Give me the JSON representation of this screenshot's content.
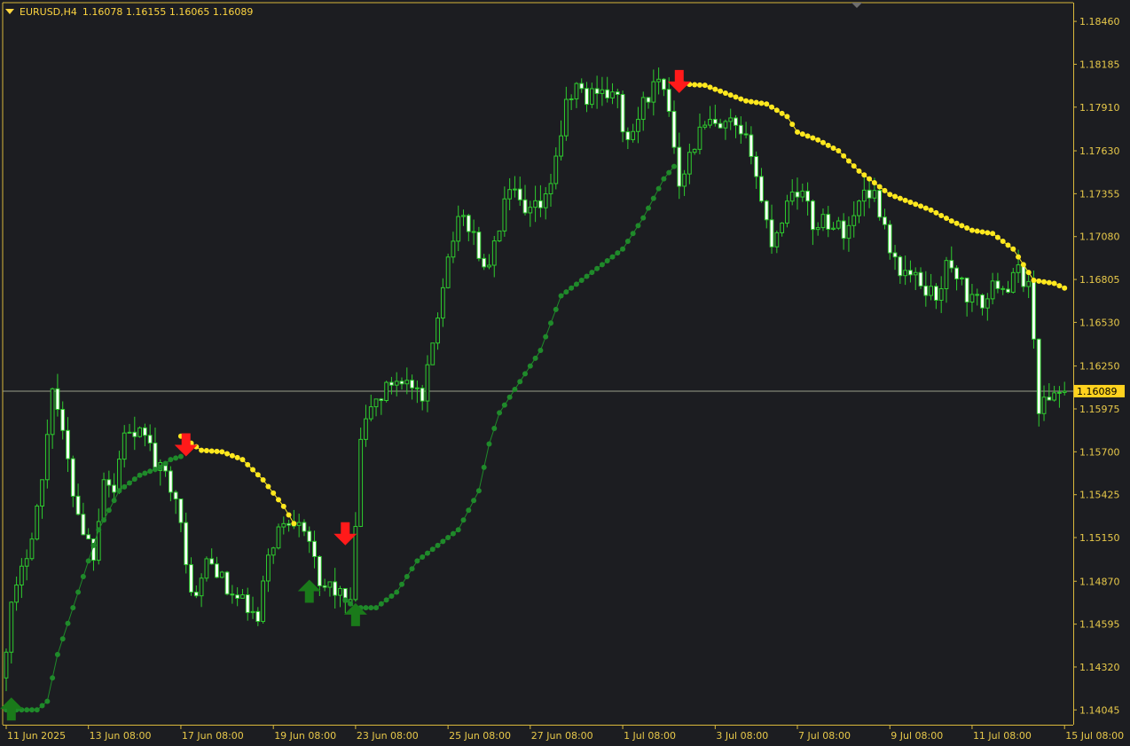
{
  "header": {
    "symbol": "EURUSD,H4",
    "quote": "1.16078 1.16155 1.16065 1.16089"
  },
  "colors": {
    "background": "#1c1d21",
    "axis": "#d9b83c",
    "axis_text": "#e8c94a",
    "candle_outline": "#2ecc2e",
    "candle_body_up": "#1c1d21",
    "candle_body_down": "#ffffff",
    "trail_up": "#1f8a2a",
    "trail_down": "#ffe81e",
    "arrow_buy": "#1a7a1a",
    "arrow_sell": "#ff1a1a",
    "last_price_line": "#9aa08a",
    "last_price_tag": "#ffd21e"
  },
  "chart_data": {
    "type": "candlestick",
    "symbol": "EURUSD",
    "timeframe": "H4",
    "y_ticks": [
      1.1846,
      1.18185,
      1.1791,
      1.1763,
      1.17355,
      1.1708,
      1.16805,
      1.1653,
      1.1625,
      1.15975,
      1.157,
      1.15425,
      1.1515,
      1.1487,
      1.14595,
      1.1432,
      1.14045
    ],
    "y_tick_labels": [
      "1.18460",
      "1.18185",
      "1.17910",
      "1.17630",
      "1.17355",
      "1.17080",
      "1.16805",
      "1.16530",
      "1.16250",
      "1.15975",
      "1.15700",
      "1.15425",
      "1.15150",
      "1.14870",
      "1.14595",
      "1.14320",
      "1.14045"
    ],
    "ylim": [
      1.1395,
      1.1858
    ],
    "last_price": 1.16089,
    "last_price_label": "1.16089",
    "x_labels": [
      "11 Jun 2025",
      "13 Jun 08:00",
      "17 Jun 08:00",
      "19 Jun 08:00",
      "23 Jun 08:00",
      "25 Jun 08:00",
      "27 Jun 08:00",
      "1 Jul 08:00",
      "3 Jul 08:00",
      "7 Jul 08:00",
      "9 Jul 08:00",
      "11 Jul 08:00",
      "15 Jul 08:00"
    ],
    "x_label_bars": [
      0,
      16,
      34,
      52,
      68,
      86,
      102,
      120,
      138,
      154,
      172,
      188,
      206
    ],
    "ohlc_keyframes": [
      [
        0,
        1.1425
      ],
      [
        2,
        1.147
      ],
      [
        4,
        1.1492
      ],
      [
        6,
        1.152
      ],
      [
        8,
        1.155
      ],
      [
        10,
        1.1615
      ],
      [
        12,
        1.158
      ],
      [
        14,
        1.1545
      ],
      [
        16,
        1.152
      ],
      [
        18,
        1.1505
      ],
      [
        20,
        1.1555
      ],
      [
        22,
        1.1545
      ],
      [
        24,
        1.1585
      ],
      [
        26,
        1.1575
      ],
      [
        28,
        1.1585
      ],
      [
        30,
        1.156
      ],
      [
        32,
        1.1555
      ],
      [
        34,
        1.1545
      ],
      [
        36,
        1.1495
      ],
      [
        38,
        1.1475
      ],
      [
        40,
        1.15
      ],
      [
        42,
        1.1495
      ],
      [
        44,
        1.148
      ],
      [
        46,
        1.1475
      ],
      [
        48,
        1.147
      ],
      [
        50,
        1.146
      ],
      [
        52,
        1.1505
      ],
      [
        54,
        1.152
      ],
      [
        56,
        1.1525
      ],
      [
        58,
        1.153
      ],
      [
        60,
        1.1515
      ],
      [
        62,
        1.148
      ],
      [
        64,
        1.1485
      ],
      [
        66,
        1.1478
      ],
      [
        68,
        1.147
      ],
      [
        70,
        1.1575
      ],
      [
        72,
        1.16
      ],
      [
        74,
        1.1605
      ],
      [
        76,
        1.1615
      ],
      [
        78,
        1.1618
      ],
      [
        80,
        1.161
      ],
      [
        82,
        1.16
      ],
      [
        84,
        1.164
      ],
      [
        86,
        1.168
      ],
      [
        88,
        1.171
      ],
      [
        90,
        1.172
      ],
      [
        92,
        1.171
      ],
      [
        94,
        1.1685
      ],
      [
        96,
        1.17
      ],
      [
        98,
        1.173
      ],
      [
        100,
        1.1735
      ],
      [
        102,
        1.172
      ],
      [
        104,
        1.1725
      ],
      [
        106,
        1.173
      ],
      [
        108,
        1.176
      ],
      [
        110,
        1.179
      ],
      [
        112,
        1.1805
      ],
      [
        114,
        1.1795
      ],
      [
        116,
        1.1805
      ],
      [
        118,
        1.18
      ],
      [
        120,
        1.1795
      ],
      [
        122,
        1.1765
      ],
      [
        124,
        1.1785
      ],
      [
        126,
        1.18
      ],
      [
        128,
        1.1805
      ],
      [
        130,
        1.179
      ],
      [
        132,
        1.1745
      ],
      [
        134,
        1.176
      ],
      [
        136,
        1.1775
      ],
      [
        138,
        1.178
      ],
      [
        140,
        1.1775
      ],
      [
        142,
        1.178
      ],
      [
        144,
        1.177
      ],
      [
        146,
        1.1765
      ],
      [
        148,
        1.173
      ],
      [
        150,
        1.1705
      ],
      [
        152,
        1.172
      ],
      [
        154,
        1.174
      ],
      [
        156,
        1.1735
      ],
      [
        158,
        1.1715
      ],
      [
        160,
        1.172
      ],
      [
        162,
        1.1715
      ],
      [
        164,
        1.1712
      ],
      [
        166,
        1.172
      ],
      [
        168,
        1.174
      ],
      [
        170,
        1.1735
      ],
      [
        172,
        1.1715
      ],
      [
        174,
        1.169
      ],
      [
        176,
        1.1685
      ],
      [
        178,
        1.168
      ],
      [
        180,
        1.1675
      ],
      [
        182,
        1.167
      ],
      [
        184,
        1.1688
      ],
      [
        186,
        1.1685
      ],
      [
        188,
        1.167
      ],
      [
        190,
        1.1665
      ],
      [
        192,
        1.1668
      ],
      [
        194,
        1.168
      ],
      [
        196,
        1.1675
      ],
      [
        198,
        1.1685
      ],
      [
        200,
        1.1678
      ],
      [
        202,
        1.16
      ],
      [
        204,
        1.1603
      ],
      [
        205,
        1.16089
      ]
    ],
    "trailing_stop": {
      "up_segments": [
        [
          [
            0,
            1.14045
          ],
          [
            6,
            1.14045
          ],
          [
            8,
            1.141
          ],
          [
            10,
            1.144
          ],
          [
            14,
            1.148
          ],
          [
            18,
            1.152
          ],
          [
            22,
            1.1545
          ],
          [
            26,
            1.1555
          ],
          [
            30,
            1.156
          ],
          [
            32,
            1.1565
          ],
          [
            34,
            1.1567
          ]
        ],
        [
          [
            66,
            1.1475
          ],
          [
            68,
            1.147
          ],
          [
            72,
            1.147
          ],
          [
            76,
            1.148
          ],
          [
            80,
            1.15
          ],
          [
            84,
            1.151
          ],
          [
            88,
            1.152
          ],
          [
            92,
            1.1545
          ],
          [
            94,
            1.1575
          ],
          [
            96,
            1.1595
          ],
          [
            100,
            1.1615
          ],
          [
            104,
            1.1635
          ],
          [
            108,
            1.167
          ],
          [
            112,
            1.168
          ],
          [
            116,
            1.169
          ],
          [
            120,
            1.17
          ],
          [
            124,
            1.172
          ],
          [
            128,
            1.1745
          ],
          [
            130,
            1.1753
          ]
        ]
      ],
      "down_segments": [
        [
          [
            34,
            1.158
          ],
          [
            38,
            1.1571
          ],
          [
            42,
            1.157
          ],
          [
            46,
            1.1565
          ],
          [
            50,
            1.1552
          ],
          [
            54,
            1.1535
          ],
          [
            56,
            1.1524
          ]
        ],
        [
          [
            131,
            1.1806
          ],
          [
            136,
            1.1805
          ],
          [
            140,
            1.18
          ],
          [
            144,
            1.1795
          ],
          [
            148,
            1.1793
          ],
          [
            152,
            1.1785
          ],
          [
            154,
            1.1775
          ],
          [
            158,
            1.177
          ],
          [
            162,
            1.1763
          ],
          [
            166,
            1.175
          ],
          [
            170,
            1.174
          ],
          [
            172,
            1.1735
          ],
          [
            176,
            1.173
          ],
          [
            180,
            1.1725
          ],
          [
            184,
            1.1718
          ],
          [
            188,
            1.1712
          ],
          [
            192,
            1.171
          ],
          [
            196,
            1.17
          ],
          [
            198,
            1.169
          ],
          [
            200,
            1.168
          ],
          [
            204,
            1.1678
          ],
          [
            206,
            1.1675
          ]
        ]
      ]
    },
    "signals": [
      {
        "type": "buy",
        "bar": 1,
        "price": 1.14045
      },
      {
        "type": "sell",
        "bar": 35,
        "price": 1.1575
      },
      {
        "type": "buy",
        "bar": 59,
        "price": 1.148
      },
      {
        "type": "sell",
        "bar": 66,
        "price": 1.1518
      },
      {
        "type": "buy",
        "bar": 68,
        "price": 1.1465
      },
      {
        "type": "sell",
        "bar": 131,
        "price": 1.1808
      }
    ],
    "bar_count": 207
  }
}
